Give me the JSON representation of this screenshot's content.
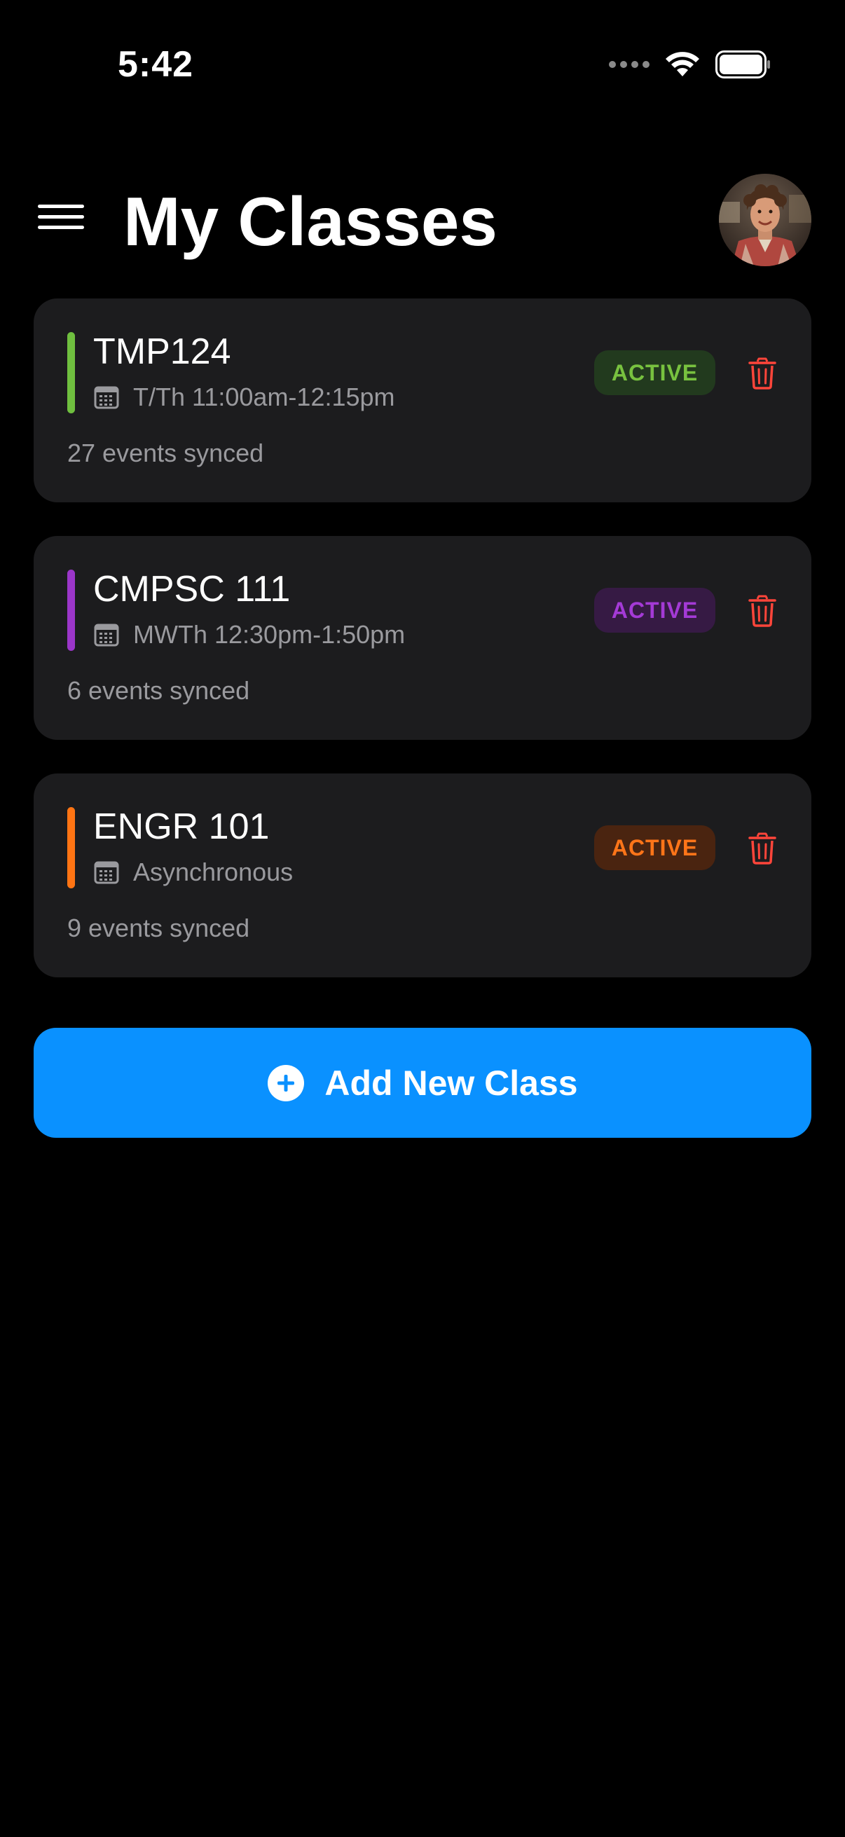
{
  "status_bar": {
    "time": "5:42",
    "signal_icon": "signal-dots-icon",
    "wifi_icon": "wifi-icon",
    "battery_icon": "battery-icon"
  },
  "header": {
    "title": "My Classes",
    "menu_icon": "hamburger-menu-icon",
    "avatar": "profile-avatar"
  },
  "classes": [
    {
      "name": "TMP124",
      "schedule": "T/Th 11:00am-12:15pm",
      "synced": "27 events synced",
      "status": "ACTIVE",
      "accent_color": "#6fbf3f",
      "badge_bg": "#223a1e",
      "badge_color": "#78c23f"
    },
    {
      "name": "CMPSC 111",
      "schedule": "MWTh 12:30pm-1:50pm",
      "synced": "6 events synced",
      "status": "ACTIVE",
      "accent_color": "#9b36c9",
      "badge_bg": "#361a44",
      "badge_color": "#a43ad6"
    },
    {
      "name": "ENGR 101",
      "schedule": "Asynchronous",
      "synced": "9 events synced",
      "status": "ACTIVE",
      "accent_color": "#ff7413",
      "badge_bg": "#4a2410",
      "badge_color": "#ff7519"
    }
  ],
  "add_button": {
    "label": "Add New Class",
    "icon": "plus-circle-icon",
    "color": "#0a91ff"
  },
  "colors": {
    "background": "#000000",
    "card": "#1c1c1e",
    "secondary_text": "#9a9a9e",
    "delete": "#ff453a"
  }
}
